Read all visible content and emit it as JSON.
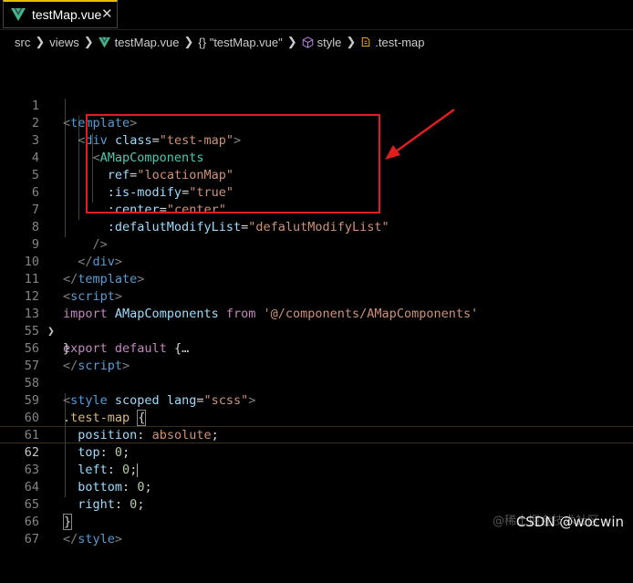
{
  "tab": {
    "label": "testMap.vue",
    "close": "✕"
  },
  "breadcrumb": {
    "items": [
      "src",
      "views",
      "testMap.vue",
      "{} \"testMap.vue\"",
      "style",
      ".test-map"
    ],
    "separator": "❯"
  },
  "editor": {
    "lines": [
      {
        "n": "1"
      },
      {
        "n": "2"
      },
      {
        "n": "3"
      },
      {
        "n": "4"
      },
      {
        "n": "5"
      },
      {
        "n": "6"
      },
      {
        "n": "7"
      },
      {
        "n": "8"
      },
      {
        "n": "9"
      },
      {
        "n": "10"
      },
      {
        "n": "11"
      },
      {
        "n": "12"
      },
      {
        "n": "13"
      },
      {
        "n": "55"
      },
      {
        "n": "56"
      },
      {
        "n": "57"
      },
      {
        "n": "58"
      },
      {
        "n": "59"
      },
      {
        "n": "60"
      },
      {
        "n": "61"
      },
      {
        "n": "62"
      },
      {
        "n": "63"
      },
      {
        "n": "64"
      },
      {
        "n": "65"
      },
      {
        "n": "66"
      },
      {
        "n": "67"
      }
    ],
    "tokens": {
      "template": "template",
      "div": "div",
      "class_attr": "class",
      "class_val": "\"test-map\"",
      "component": "AMapComponents",
      "ref_attr": "ref",
      "ref_val": "\"locationMap\"",
      "ismodify_attr": ":is-modify",
      "ismodify_val": "\"true\"",
      "center_attr": ":center",
      "center_val": "\"center\"",
      "list_attr": ":defalutModifyList",
      "list_val": "\"defalutModifyList\"",
      "script": "script",
      "import_kw": "import",
      "import_name": "AMapComponents",
      "from_kw": "from",
      "import_path": "'@/components/AMapComponents'",
      "export_kw": "export",
      "default_kw": "default",
      "folded": "{…",
      "close_brace": "}",
      "style": "style",
      "scoped": "scoped",
      "lang_attr": "lang",
      "lang_val": "\"scss\"",
      "selector": ".test-map",
      "open_brace": "{",
      "prop_position": "position",
      "val_absolute": "absolute",
      "prop_top": "top",
      "prop_left": "left",
      "prop_bottom": "bottom",
      "prop_right": "right",
      "val_zero": "0"
    }
  },
  "colors": {
    "highlight_box": "#e01e1e",
    "arrow": "#e01e1e",
    "tab_accent": "#e3c000",
    "vue_green": "#41b883"
  },
  "watermark": "CSDN @wocwin",
  "watermark_ghost": "@稀土掘金技术社区"
}
